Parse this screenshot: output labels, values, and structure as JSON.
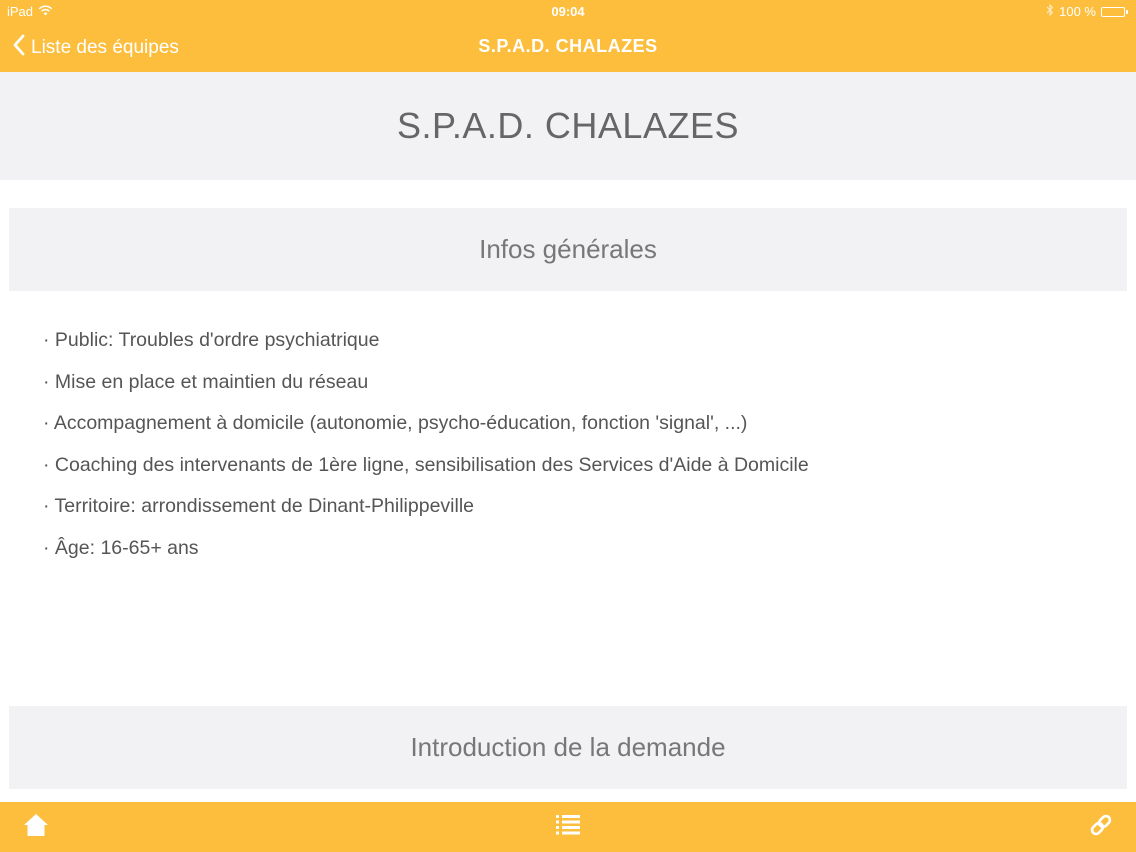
{
  "status_bar": {
    "device": "iPad",
    "time": "09:04",
    "battery": "100 %",
    "battery_level": 1.0
  },
  "nav": {
    "back_label": "Liste des équipes",
    "title": "S.P.A.D. CHALAZES"
  },
  "page": {
    "title": "S.P.A.D. CHALAZES"
  },
  "sections": {
    "general": {
      "title": "Infos générales",
      "items": [
        "· Public: Troubles d'ordre psychiatrique",
        "· Mise en place et maintien du réseau",
        "· Accompagnement à domicile (autonomie, psycho-éducation, fonction 'signal', ...)",
        "· Coaching des intervenants de 1ère ligne, sensibilisation des Services d'Aide à Domicile",
        "· Territoire: arrondissement de Dinant-Philippeville",
        "· Âge: 16-65+ ans"
      ]
    },
    "request": {
      "title": "Introduction de la demande"
    }
  },
  "colors": {
    "accent": "#fcbe3c",
    "section_bg": "#f2f2f4",
    "text": "#555555"
  },
  "icons": {
    "back": "chevron-left-icon",
    "wifi": "wifi-icon",
    "bluetooth": "bluetooth-icon",
    "battery": "battery-icon",
    "home": "home-icon",
    "list": "list-icon",
    "link": "link-icon"
  }
}
